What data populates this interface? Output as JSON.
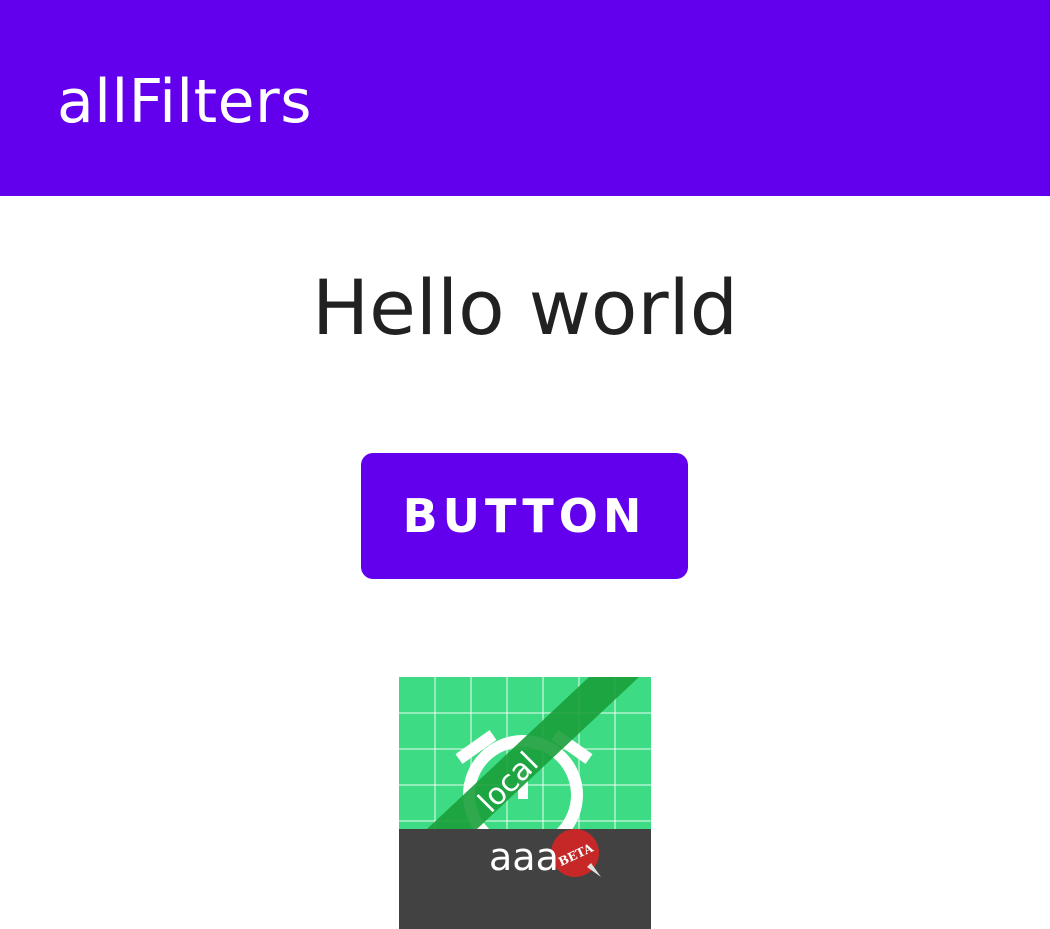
{
  "app_bar": {
    "title": "allFilters",
    "color": "#6200EE"
  },
  "main": {
    "greeting": "Hello world",
    "button_label": "BUTTON"
  },
  "app_icon": {
    "icon": "alarm-clock-icon",
    "ribbon_label": "local",
    "name_label": "aaa",
    "badge_icon": "beta-badge-icon",
    "badge_text": "BETA",
    "background_color": "#3DDC84",
    "ribbon_color": "#1A9E3A",
    "footer_color": "#424242",
    "badge_color": "#C62828"
  }
}
